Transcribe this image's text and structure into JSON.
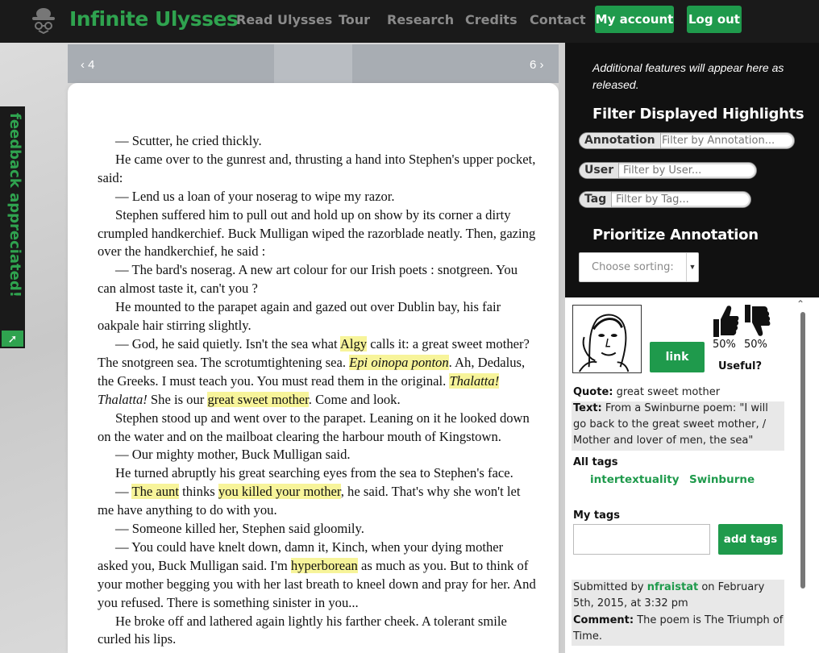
{
  "nav": {
    "brand": "Infinite Ulysses",
    "links": [
      "Read Ulysses",
      "Tour",
      "Research",
      "Credits",
      "Contact"
    ],
    "my_account": "My account",
    "log_out": "Log out"
  },
  "feedback": {
    "label": "feedback appreciated!"
  },
  "pager": {
    "prev": "‹ 4",
    "next": "6 ›"
  },
  "reading": {
    "paragraphs": [
      [
        {
          "t": "— Scutter, he cried thickly."
        }
      ],
      [
        {
          "t": "He came over to the gunrest and, thrusting a hand into Stephen's upper pocket, said:"
        }
      ],
      [
        {
          "t": "— Lend us a loan of your noserag to wipe my razor."
        }
      ],
      [
        {
          "t": "Stephen suffered him to pull out and hold up on show by its corner a dirty crumpled handkerchief. Buck Mulligan wiped the razorblade neatly. Then, gazing over the handkerchief, he said :"
        }
      ],
      [
        {
          "t": "— The bard's noserag. A new art colour for our Irish poets : snotgreen. You can almost taste it, can't you ?"
        }
      ],
      [
        {
          "t": "He mounted to the parapet again and gazed out over Dublin bay, his fair oakpale hair stirring slightly."
        }
      ],
      [
        {
          "t": "— God, he said quietly. Isn't the sea what "
        },
        {
          "t": "Algy",
          "hl": true
        },
        {
          "t": " calls it: a great sweet mother? The snotgreen sea. The scrotumtightening sea. "
        },
        {
          "t": "Epi oinopa ponton",
          "hl": true,
          "i": true
        },
        {
          "t": ". Ah, Dedalus, the Greeks. I must teach you. You must read them in the original. "
        },
        {
          "t": "Thalatta",
          "hl": true,
          "i": true
        },
        {
          "t": "! ",
          "hl": true,
          "i": true
        },
        {
          "t": "Thalatta!",
          "i": true
        },
        {
          "t": " She is our "
        },
        {
          "t": "great sweet mother",
          "hl": true
        },
        {
          "t": ". Come and look."
        }
      ],
      [
        {
          "t": "Stephen stood up and went over to the parapet. Leaning on it he looked down on the water and on the mailboat clearing the harbour mouth of Kingstown."
        }
      ],
      [
        {
          "t": "— Our mighty mother, Buck Mulligan said."
        }
      ],
      [
        {
          "t": "He turned abruptly his great searching eyes from the sea to Stephen's face."
        }
      ],
      [
        {
          "t": "— "
        },
        {
          "t": "The aunt",
          "hl": true
        },
        {
          "t": " thinks "
        },
        {
          "t": "you killed your mother",
          "hl": true
        },
        {
          "t": ", he said. That's why she won't let me have anything to do with you."
        }
      ],
      [
        {
          "t": "— Someone killed her, Stephen said gloomily."
        }
      ],
      [
        {
          "t": "— You could have knelt down, damn it, Kinch, when your dying mother asked you, Buck Mulligan said. I'm "
        },
        {
          "t": "hyperborean",
          "hl": true
        },
        {
          "t": " as much as you. But to think of your mother begging you with her last breath to kneel down and pray for her. And you refused. There is something sinister in you..."
        }
      ],
      [
        {
          "t": "He broke off and lathered again lightly his farther cheek. A tolerant smile curled his lips."
        }
      ]
    ]
  },
  "sidebar": {
    "note": "Additional features will appear here as released.",
    "filter_heading": "Filter Displayed Highlights",
    "filters": {
      "annotation": {
        "label": "Annotation",
        "placeholder": "Filter by Annotation..."
      },
      "user": {
        "label": "User",
        "placeholder": "Filter by User..."
      },
      "tag": {
        "label": "Tag",
        "placeholder": "Filter by Tag..."
      }
    },
    "prioritize_heading": "Prioritize Annotation",
    "sort_placeholder": "Choose sorting:"
  },
  "annotation": {
    "link_label": "link",
    "up_pct": "50%",
    "down_pct": "50%",
    "useful_label": "Useful?",
    "quote_label": "Quote:",
    "quote": "great sweet mother",
    "text_label": "Text:",
    "text": "From a Swinburne poem: \"I will go back to the great sweet mother, / Mother and lover of men, the sea\"",
    "all_tags_label": "All tags",
    "tags": [
      "intertextuality",
      "Swinburne"
    ],
    "my_tags_label": "My tags",
    "add_tags_label": "add tags",
    "submitted_by_label": "Submitted by",
    "submitted_user": "nfraistat",
    "submitted_date": "on February 5th, 2015, at 3:32 pm",
    "comment_label": "Comment:",
    "comment": "The poem is The Triumph of Time."
  },
  "colors": {
    "brand_green": "#2fa34f",
    "button_green": "#1f9a4c",
    "highlight": "#f7f49a",
    "navbar": "#1a1a1a"
  }
}
